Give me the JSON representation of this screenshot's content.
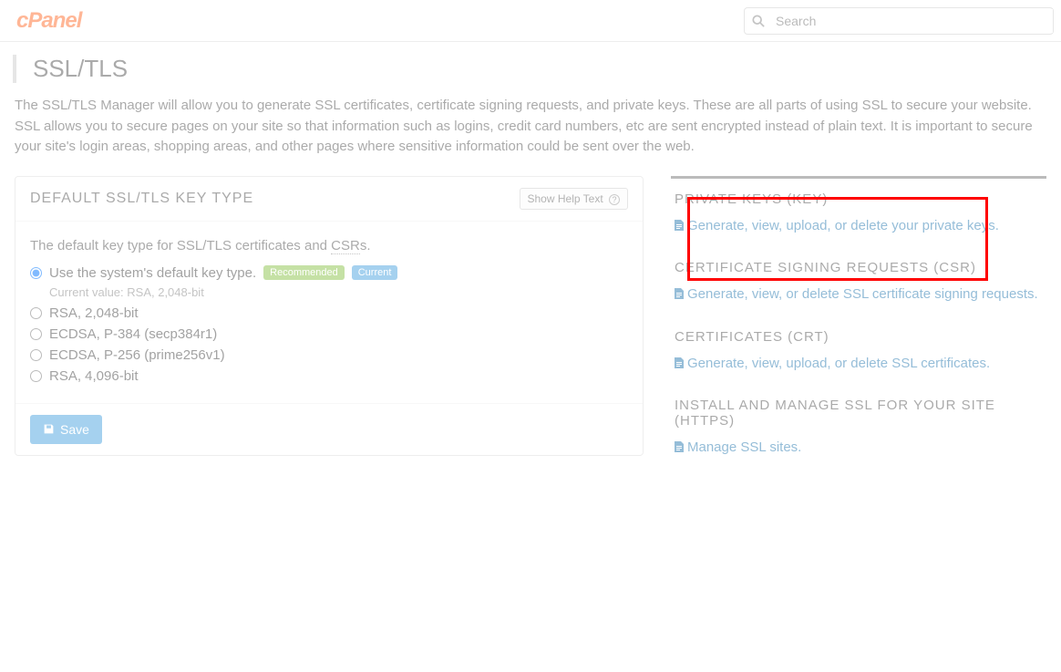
{
  "header": {
    "logo_text": "cPanel",
    "search_placeholder": "Search"
  },
  "page": {
    "title": "SSL/TLS",
    "intro": "The SSL/TLS Manager will allow you to generate SSL certificates, certificate signing requests, and private keys. These are all parts of using SSL to secure your website. SSL allows you to secure pages on your site so that information such as logins, credit card numbers, etc are sent encrypted instead of plain text. It is important to secure your site's login areas, shopping areas, and other pages where sensitive information could be sent over the web."
  },
  "panel": {
    "title": "DEFAULT SSL/TLS KEY TYPE",
    "help_label": "Show Help Text",
    "desc_prefix": "The default key type for SSL/TLS certificates and ",
    "desc_abbr": "CSR",
    "desc_suffix": "s.",
    "options": [
      {
        "label": "Use the system's default key type.",
        "recommended": true,
        "current": true,
        "checked": true
      },
      {
        "label": "RSA, 2,048-bit"
      },
      {
        "label": "ECDSA, P-384 (secp384r1)"
      },
      {
        "label": "ECDSA, P-256 (prime256v1)"
      },
      {
        "label": "RSA, 4,096-bit"
      }
    ],
    "badge_recommended": "Recommended",
    "badge_current": "Current",
    "current_value_label": "Current value: RSA, 2,048-bit",
    "save_label": "Save"
  },
  "sidebar": {
    "sections": [
      {
        "title": "PRIVATE KEYS (KEY)",
        "link": "Generate, view, upload, or delete your private keys."
      },
      {
        "title": "CERTIFICATE SIGNING REQUESTS (CSR)",
        "link": "Generate, view, or delete SSL certificate signing requests."
      },
      {
        "title": "CERTIFICATES (CRT)",
        "link": "Generate, view, upload, or delete SSL certificates."
      },
      {
        "title": "INSTALL AND MANAGE SSL FOR YOUR SITE (HTTPS)",
        "link": "Manage SSL sites."
      }
    ]
  }
}
